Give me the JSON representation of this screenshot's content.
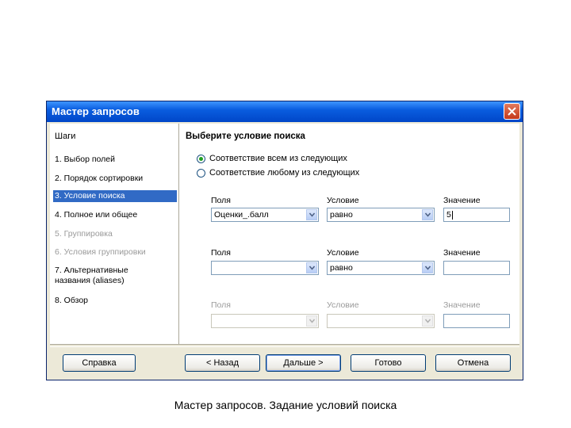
{
  "window": {
    "title": "Мастер запросов"
  },
  "sidebar": {
    "title": "Шаги",
    "steps": [
      {
        "label": "1. Выбор полей",
        "state": "normal"
      },
      {
        "label": "2. Порядок сортировки",
        "state": "normal"
      },
      {
        "label": "3. Условие поиска",
        "state": "active"
      },
      {
        "label": "4. Полное или общее",
        "state": "normal"
      },
      {
        "label": "5. Группировка",
        "state": "disabled"
      },
      {
        "label": "6. Условия группировки",
        "state": "disabled"
      },
      {
        "label": "7. Альтернативные названия (aliases)",
        "state": "normal"
      },
      {
        "label": "8. Обзор",
        "state": "normal"
      }
    ]
  },
  "main": {
    "heading": "Выберите условие поиска",
    "options": [
      {
        "label": "Соответствие всем из следующих",
        "checked": true
      },
      {
        "label": "Соответствие любому из следующих",
        "checked": false
      }
    ],
    "rows": [
      {
        "field_label": "Поля",
        "field_value": "Оценки_.балл",
        "condition_label": "Условие",
        "condition_value": "равно",
        "value_label": "Значение",
        "value": "5",
        "enabled": true
      },
      {
        "field_label": "Поля",
        "field_value": "",
        "condition_label": "Условие",
        "condition_value": "равно",
        "value_label": "Значение",
        "value": "",
        "enabled": true
      },
      {
        "field_label": "Поля",
        "field_value": "",
        "condition_label": "Условие",
        "condition_value": "",
        "value_label": "Значение",
        "value": "",
        "enabled": false
      }
    ]
  },
  "buttons": {
    "help": "Справка",
    "back": "< Назад",
    "next": "Дальше >",
    "finish": "Готово",
    "cancel": "Отмена"
  },
  "caption": "Мастер запросов. Задание условий поиска",
  "colors": {
    "titlebar": "#0a5ddf",
    "selection": "#316ac5",
    "dialog_bg": "#ece9d8"
  },
  "icons": [
    "close-icon",
    "chevron-down-icon"
  ]
}
